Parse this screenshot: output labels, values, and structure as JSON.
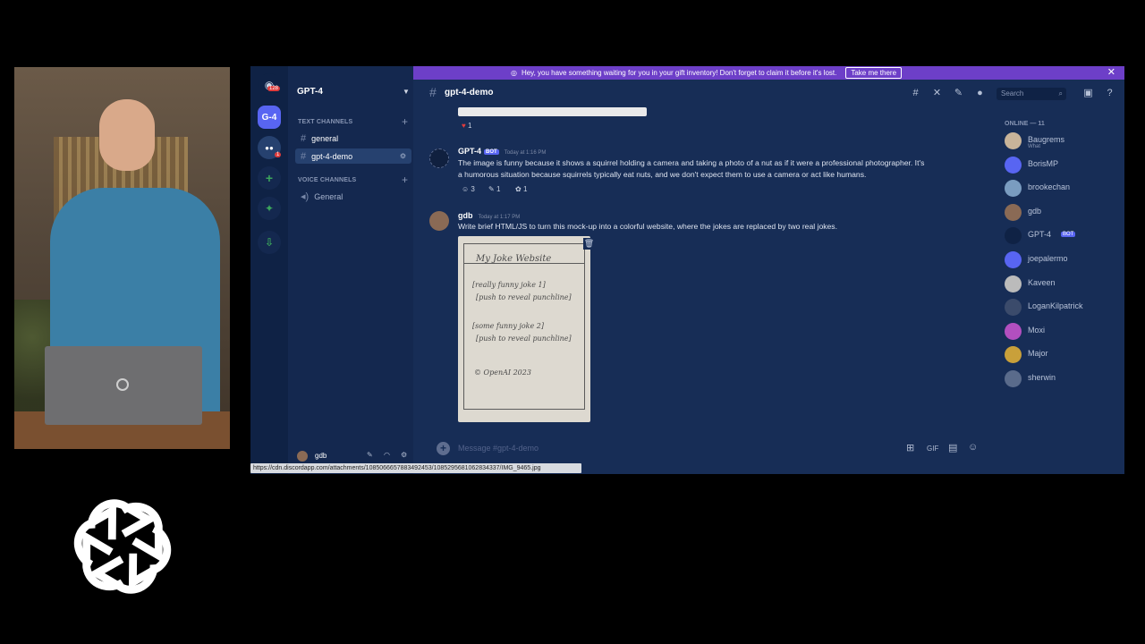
{
  "banner": {
    "text": "Hey, you have something waiting for you in your gift inventory! Don't forget to claim it before it's lost.",
    "button": "Take me there"
  },
  "servers": {
    "unread_count": "128",
    "active_server": "G-4",
    "badge": "1"
  },
  "guild": {
    "name": "GPT-4"
  },
  "channels": {
    "text_category": "TEXT CHANNELS",
    "voice_category": "VOICE CHANNELS",
    "items": [
      {
        "label": "general"
      },
      {
        "label": "gpt-4-demo"
      }
    ],
    "voice_items": [
      {
        "label": "General"
      }
    ]
  },
  "topbar": {
    "channel": "gpt-4-demo",
    "search_placeholder": "Search"
  },
  "messages": [
    {
      "author": "GPT-4",
      "bot_tag": "BOT",
      "time": "Today at 1:16 PM",
      "line1": "The image is funny because it shows a squirrel holding a camera and taking a photo of a nut as if it were a professional photographer. It's",
      "line2": "a humorous situation because squirrels typically eat nuts, and we don't expect them to use a camera or act like humans.",
      "reactions": [
        "3",
        "1",
        "1"
      ]
    },
    {
      "author": "gdb",
      "time": "Today at 1:17 PM",
      "line1": "Write brief HTML/JS to turn this mock-up into a colorful website, where the jokes are replaced by two real jokes."
    }
  ],
  "prior_reaction": "1",
  "mockup": {
    "title": "My Joke Website",
    "line1": "[really funny joke 1]",
    "line2": "[push to reveal punchline]",
    "line3": "[some funny joke 2]",
    "line4": "[push to reveal punchline]",
    "footer": "© OpenAI 2023"
  },
  "compose": {
    "placeholder": "Message #gpt-4-demo"
  },
  "members": {
    "header": "ONLINE — 11",
    "list": [
      {
        "name": "Baugrems",
        "sub": "What"
      },
      {
        "name": "BorisMP"
      },
      {
        "name": "brookechan"
      },
      {
        "name": "gdb"
      },
      {
        "name": "GPT-4",
        "tag": "BOT"
      },
      {
        "name": "joepalermo"
      },
      {
        "name": "Kaveen"
      },
      {
        "name": "LoganKilpatrick"
      },
      {
        "name": "Moxi"
      },
      {
        "name": "Major"
      },
      {
        "name": "sherwin"
      }
    ]
  },
  "user": {
    "name": "gdb"
  },
  "status_url": "https://cdn.discordapp.com/attachments/1085066657883492453/1085295681062834337/IMG_9465.jpg",
  "colors": {
    "bg": "#172d56",
    "banner": "#6d3fc8",
    "blurple": "#5865f2"
  }
}
